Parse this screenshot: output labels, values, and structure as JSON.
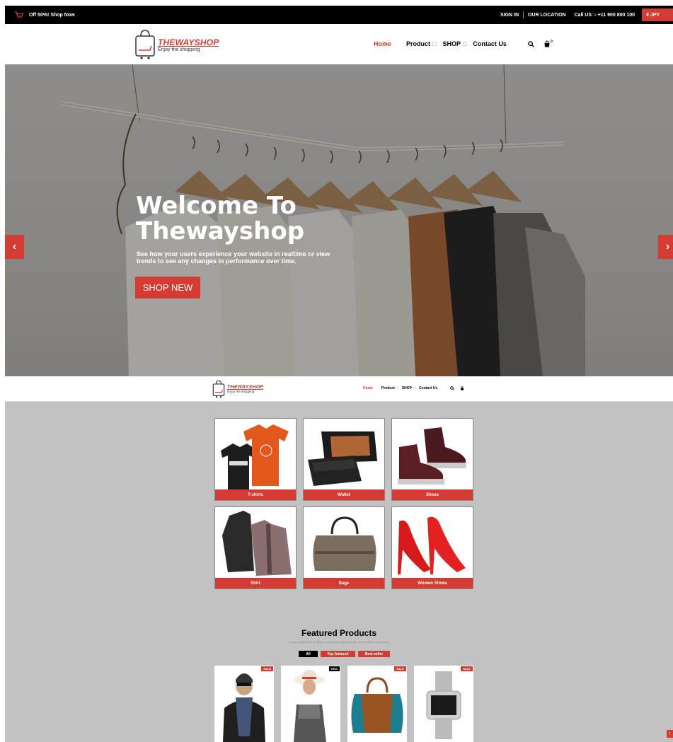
{
  "topbar": {
    "offer": "Off 50%! Shop Now",
    "sign_in": "SIGN IN",
    "location": "OUR LOCATION",
    "call": "Call US :- +11 900 800 100",
    "currency": "¥ JPY"
  },
  "logo": {
    "brand": "THEWAYSHOP",
    "tagline": "Enjoy the shopping"
  },
  "nav": {
    "home": "Home",
    "product": "Product",
    "shop": "SHOP",
    "contact": "Contact Us",
    "caret": "□",
    "cart_count": "0"
  },
  "hero": {
    "title_line1": "Welcome To",
    "title_line2": "Thewayshop",
    "description": "See how your users experience your website in realtime or view trends to see any changes in performance over time.",
    "button": "SHOP NEW",
    "prev": "‹",
    "next": "›"
  },
  "categories": [
    "T-shirts",
    "Wallet",
    "Shoes",
    "Shirt",
    "Bags",
    "Women Shoes"
  ],
  "featured": {
    "title": "Featured Products",
    "subtitle": "Lorem ipsum dolor sit amet, consectetur adipiscing elit. Sed sit amet lacus enim.",
    "filters": {
      "all": "All",
      "top": "Top featured",
      "best": "Best seller"
    },
    "badges": [
      "SALE",
      "NEW",
      "SALE",
      "SALE"
    ]
  },
  "colors": {
    "accent": "#d33b33",
    "dark": "#000000",
    "content_bg": "#c2c2c2"
  }
}
